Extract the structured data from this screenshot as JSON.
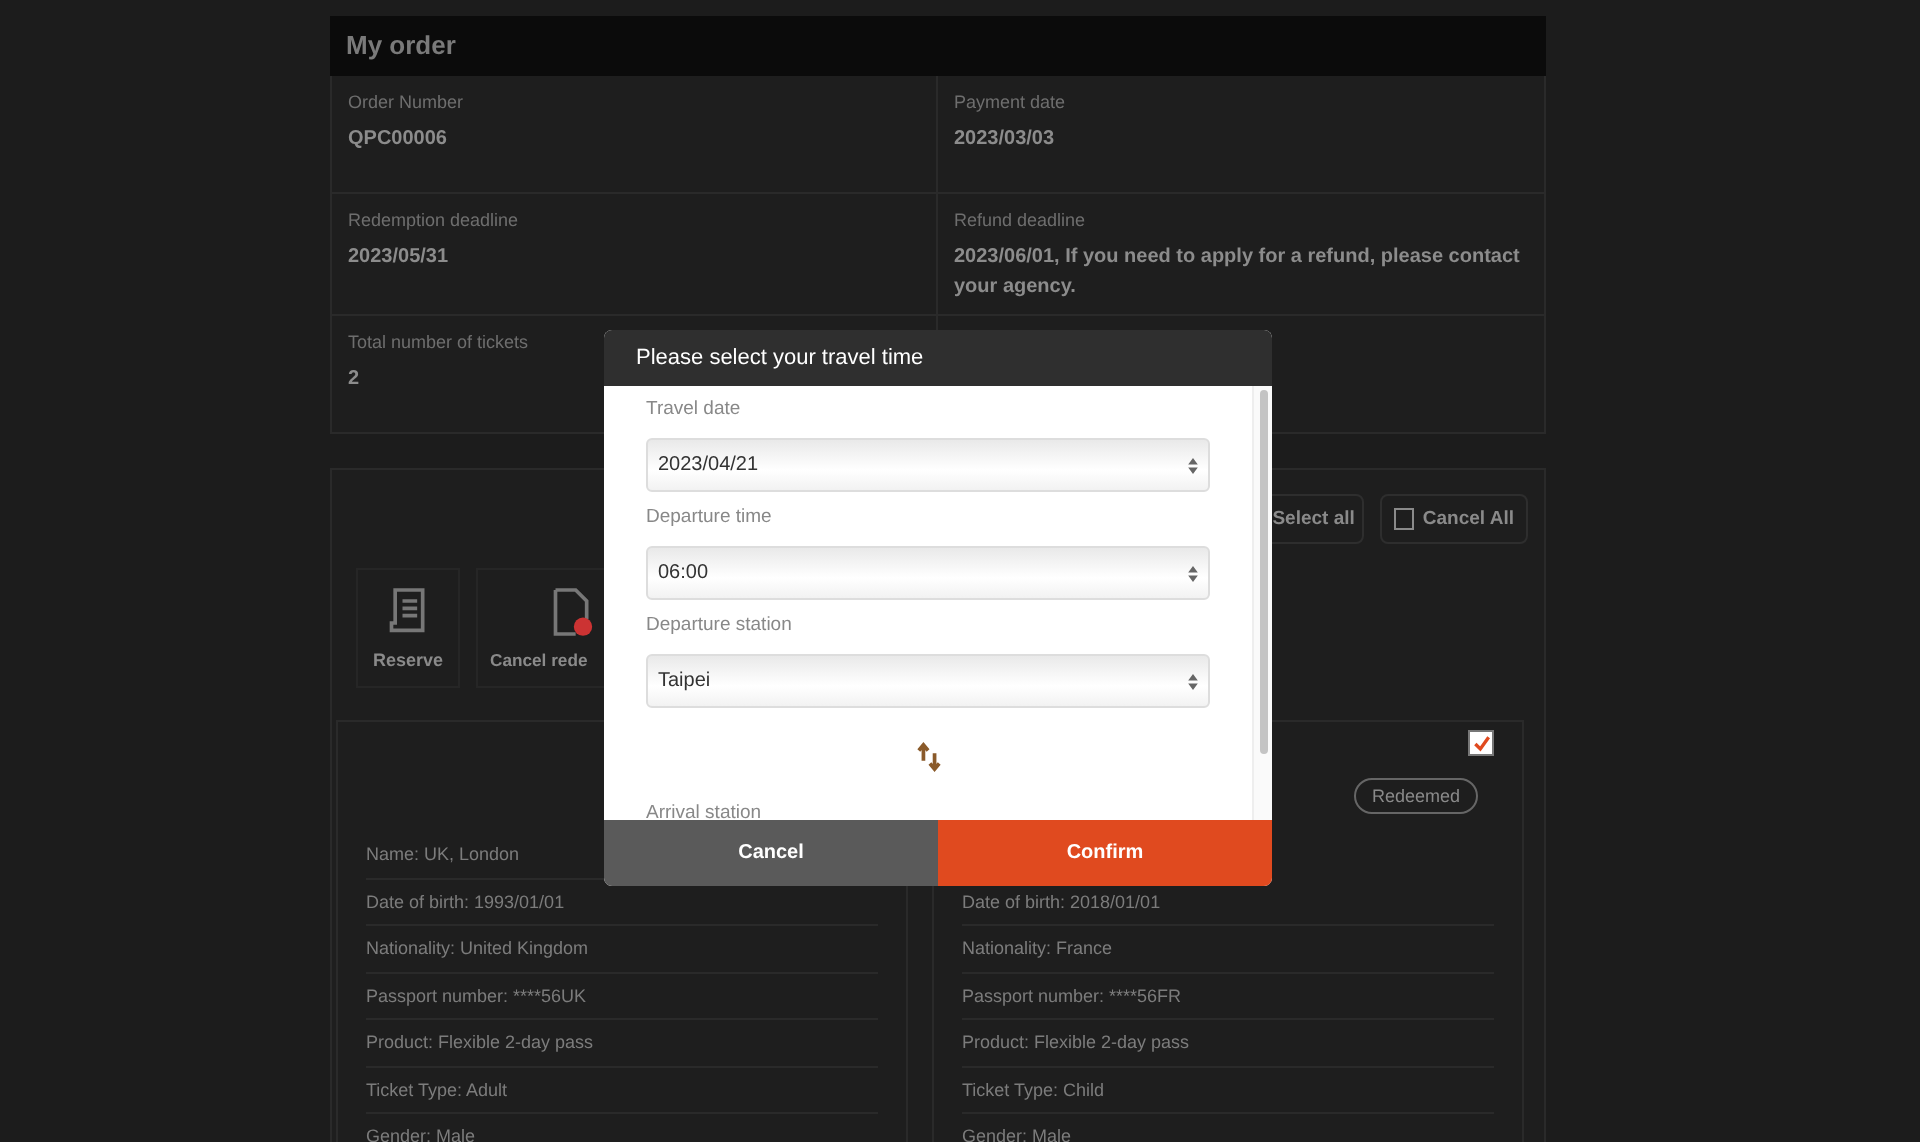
{
  "page": {
    "title": "My order",
    "info": [
      {
        "label": "Order Number",
        "value": "QPC00006"
      },
      {
        "label": "Payment date",
        "value": "2023/03/03"
      },
      {
        "label": "Redemption deadline",
        "value": "2023/05/31"
      },
      {
        "label": "Refund deadline",
        "value": "2023/06/01, If you need to apply for a refund, please contact your agency."
      },
      {
        "label": "Total number of tickets",
        "value": "2"
      }
    ],
    "toolbar": [
      {
        "label": "Select all",
        "kind": "plain"
      },
      {
        "label": "Cancel All",
        "kind": "square"
      }
    ],
    "actions": [
      {
        "label": "Reserve",
        "kind": "list"
      },
      {
        "label": "Cancel rede",
        "kind": "cancel"
      }
    ],
    "tickets": [
      {
        "lines": [
          "Name: UK, London",
          "Date of birth: 1993/01/01",
          "Nationality: United Kingdom",
          "Passport number: ****56UK",
          "Product: Flexible 2-day pass",
          "Ticket Type: Adult",
          "Gender: Male"
        ]
      },
      {
        "checked": true,
        "status": "Redeemed",
        "lines": [
          "Date of birth: 2018/01/01",
          "Nationality: France",
          "Passport number: ****56FR",
          "Product: Flexible 2-day pass",
          "Ticket Type: Child",
          "Gender: Male"
        ]
      }
    ]
  },
  "dialog": {
    "title": "Please select your travel time",
    "fields": [
      {
        "label": "Travel date",
        "value": "2023/04/21"
      },
      {
        "label": "Departure time",
        "value": "06:00"
      },
      {
        "label": "Departure station",
        "value": "Taipei"
      },
      {
        "label": "Arrival station"
      }
    ],
    "buttons": [
      {
        "label": "Cancel",
        "kind": "secondary"
      },
      {
        "label": "Confirm",
        "kind": "primary"
      }
    ]
  }
}
